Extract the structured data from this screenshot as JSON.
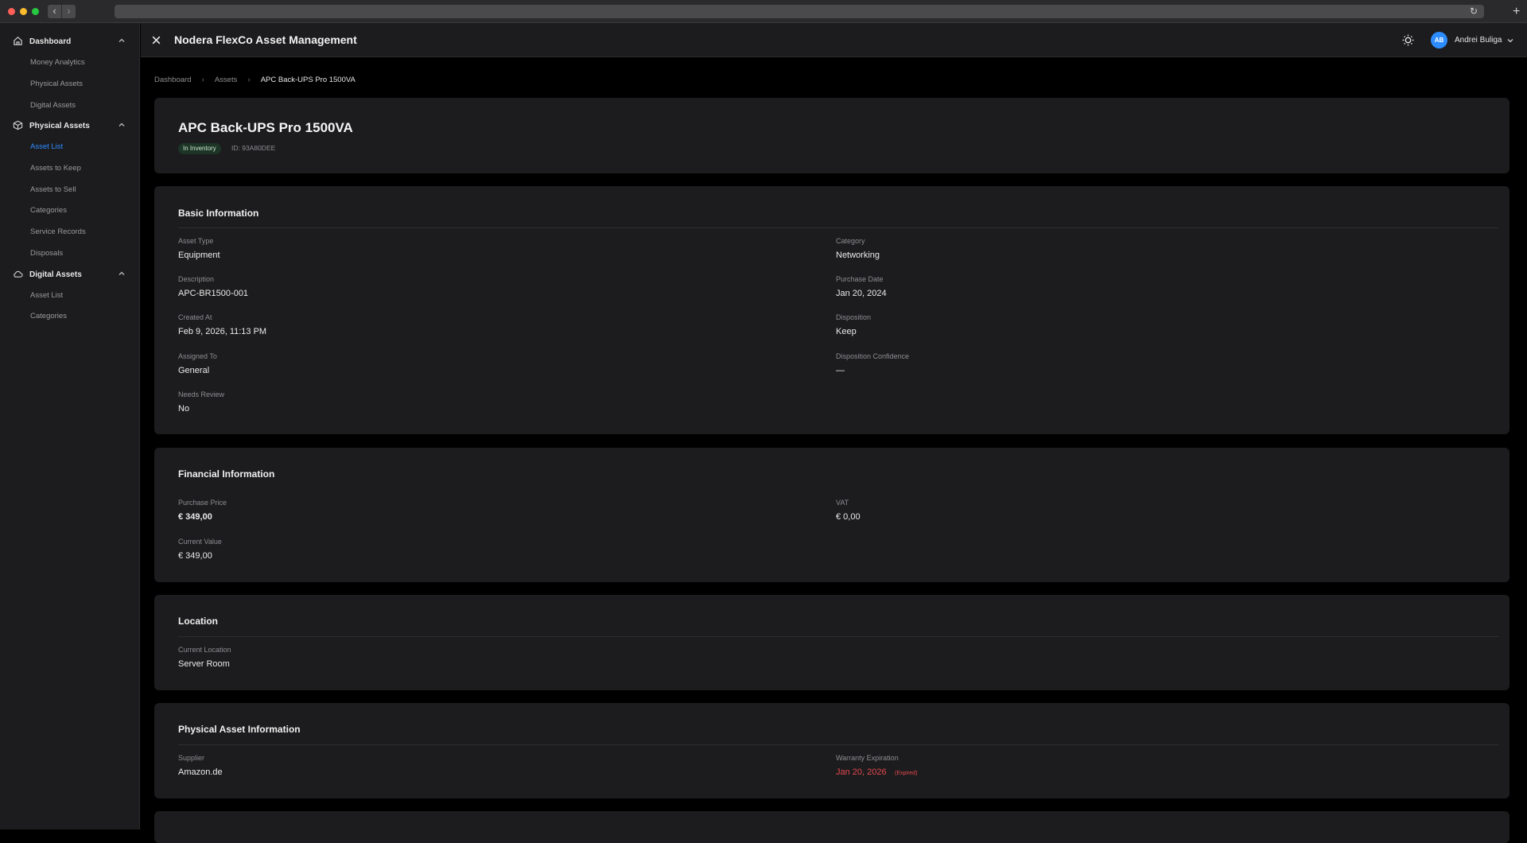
{
  "browser": {
    "back_icon": "chevron-left-icon",
    "forward_icon": "chevron-right-icon",
    "reload_icon": "reload-icon",
    "new_tab_icon": "plus-icon"
  },
  "sidebar": {
    "groups": [
      {
        "label": "Dashboard",
        "icon": "home-icon",
        "items": [
          "Money Analytics",
          "Physical Assets",
          "Digital Assets"
        ]
      },
      {
        "label": "Physical Assets",
        "icon": "box-icon",
        "items": [
          "Asset List",
          "Assets to Keep",
          "Assets to Sell",
          "Categories",
          "Service Records",
          "Disposals"
        ],
        "active": "Asset List"
      },
      {
        "label": "Digital Assets",
        "icon": "cloud-icon",
        "items": [
          "Asset List",
          "Categories"
        ]
      }
    ]
  },
  "header": {
    "title": "Nodera FlexCo Asset Management",
    "user_initials": "AB",
    "user_name": "Andrei Buliga"
  },
  "breadcrumb": [
    "Dashboard",
    "Assets",
    "APC Back-UPS Pro 1500VA"
  ],
  "asset": {
    "name": "APC Back-UPS Pro 1500VA",
    "status": "In Inventory",
    "id_text": "ID: 93A80DEE"
  },
  "basic": {
    "title": "Basic Information",
    "asset_type_label": "Asset Type",
    "asset_type": "Equipment",
    "category_label": "Category",
    "category": "Networking",
    "description_label": "Description",
    "description": "APC-BR1500-001",
    "purchase_date_label": "Purchase Date",
    "purchase_date": "Jan 20, 2024",
    "created_at_label": "Created At",
    "created_at": "Feb 9, 2026, 11:13 PM",
    "disposition_label": "Disposition",
    "disposition": "Keep",
    "assigned_to_label": "Assigned To",
    "assigned_to": "General",
    "disposition_confidence_label": "Disposition Confidence",
    "disposition_confidence": "—",
    "needs_review_label": "Needs Review",
    "needs_review": "No"
  },
  "financial": {
    "title": "Financial Information",
    "purchase_price_label": "Purchase Price",
    "purchase_price": "€ 349,00",
    "vat_label": "VAT",
    "vat": "€ 0,00",
    "current_value_label": "Current Value",
    "current_value": "€ 349,00"
  },
  "location": {
    "title": "Location",
    "current_location_label": "Current Location",
    "current_location": "Server Room"
  },
  "physical": {
    "title": "Physical Asset Information",
    "supplier_label": "Supplier",
    "supplier": "Amazon.de",
    "warranty_label": "Warranty Expiration",
    "warranty": "Jan 20, 2026",
    "warranty_status": "(Expired)"
  },
  "colors": {
    "accent": "#2d8cff",
    "danger": "#e5484d",
    "success_bg": "#1d3527"
  }
}
